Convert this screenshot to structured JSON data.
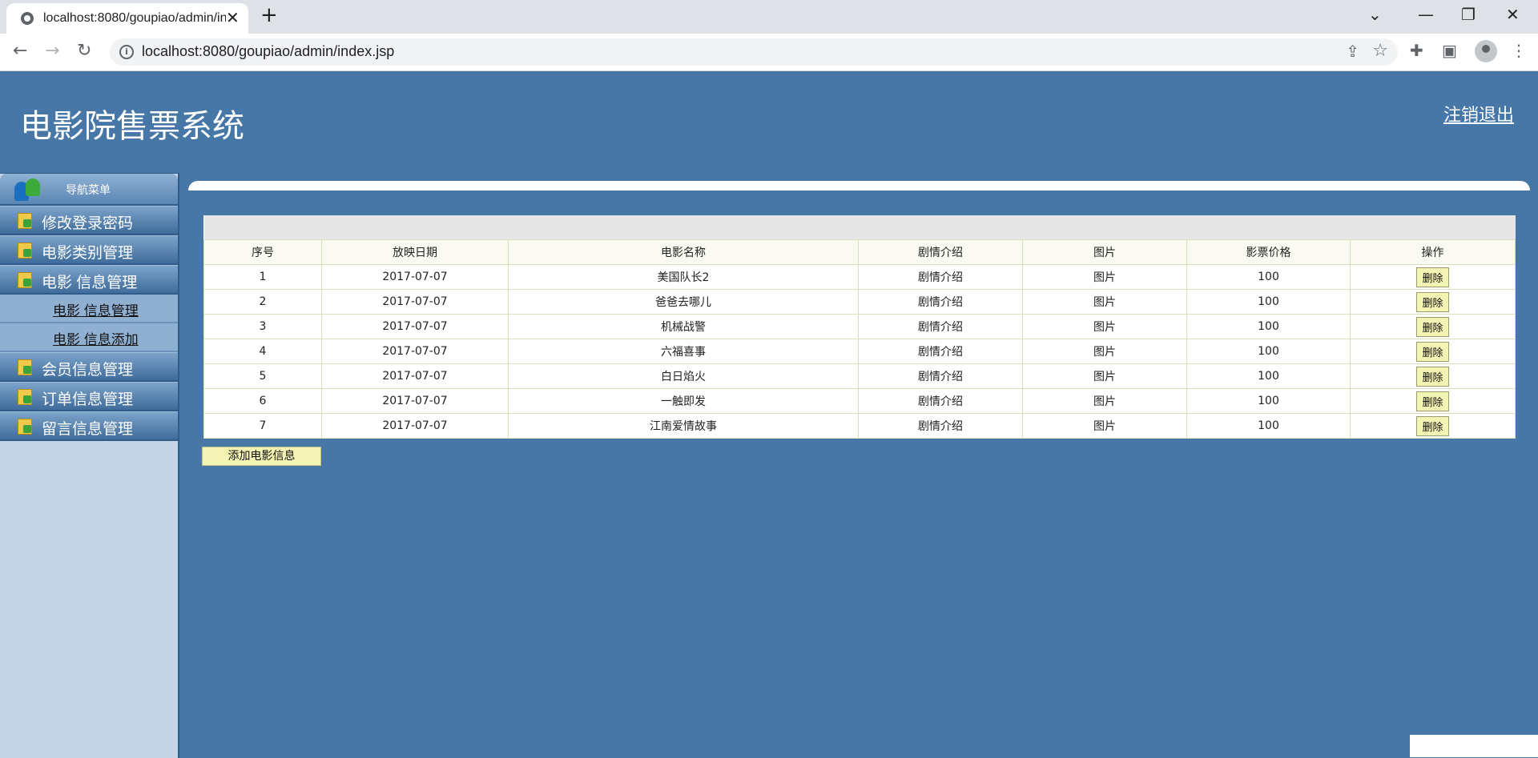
{
  "browser": {
    "tab_title": "localhost:8080/goupiao/admin/index.jsp",
    "url": "localhost:8080/goupiao/admin/index.jsp"
  },
  "header": {
    "app_title": "电影院售票系统",
    "logout_label": "注销退出"
  },
  "sidebar": {
    "title": "导航菜单",
    "items": [
      {
        "label": "修改登录密码"
      },
      {
        "label": "电影类别管理"
      },
      {
        "label": "电影 信息管理",
        "expanded": true,
        "children": [
          {
            "label": "电影 信息管理"
          },
          {
            "label": "电影 信息添加"
          }
        ]
      },
      {
        "label": "会员信息管理"
      },
      {
        "label": "订单信息管理"
      },
      {
        "label": "留言信息管理"
      }
    ]
  },
  "table": {
    "columns": [
      "序号",
      "放映日期",
      "电影名称",
      "剧情介绍",
      "图片",
      "影票价格",
      "操作"
    ],
    "rows": [
      {
        "no": "1",
        "date": "2017-07-07",
        "name": "美国队长2",
        "plot": "剧情介绍",
        "pic": "图片",
        "price": "100",
        "action": "删除"
      },
      {
        "no": "2",
        "date": "2017-07-07",
        "name": "爸爸去哪儿",
        "plot": "剧情介绍",
        "pic": "图片",
        "price": "100",
        "action": "删除"
      },
      {
        "no": "3",
        "date": "2017-07-07",
        "name": "机械战警",
        "plot": "剧情介绍",
        "pic": "图片",
        "price": "100",
        "action": "删除"
      },
      {
        "no": "4",
        "date": "2017-07-07",
        "name": "六福喜事",
        "plot": "剧情介绍",
        "pic": "图片",
        "price": "100",
        "action": "删除"
      },
      {
        "no": "5",
        "date": "2017-07-07",
        "name": "白日焰火",
        "plot": "剧情介绍",
        "pic": "图片",
        "price": "100",
        "action": "删除"
      },
      {
        "no": "6",
        "date": "2017-07-07",
        "name": "一触即发",
        "plot": "剧情介绍",
        "pic": "图片",
        "price": "100",
        "action": "删除"
      },
      {
        "no": "7",
        "date": "2017-07-07",
        "name": "江南爱情故事",
        "plot": "剧情介绍",
        "pic": "图片",
        "price": "100",
        "action": "删除"
      }
    ]
  },
  "add_button_label": "添加电影信息",
  "colors": {
    "page_bg": "#4677a6",
    "sidebar_bg": "#c4d4e4",
    "button_bg": "#f3f3b3"
  }
}
